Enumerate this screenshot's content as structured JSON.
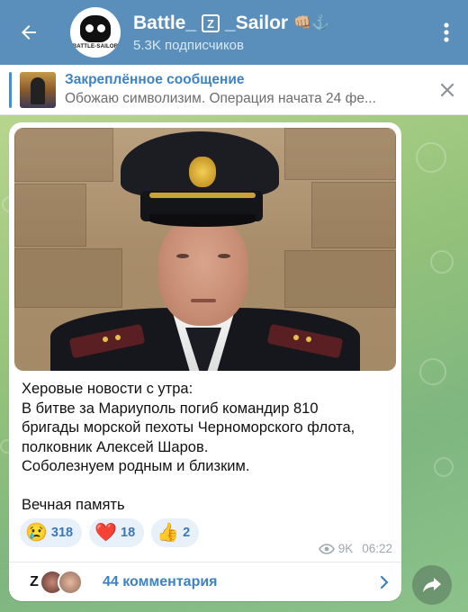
{
  "header": {
    "title_prefix": "Battle_",
    "title_z": "Z",
    "title_suffix": "_Sailor",
    "title_emoji": "👊🏼⚓",
    "subscribers": "5.3K подписчиков",
    "avatar_text": "BATTLE-SAILOR",
    "icons": {
      "back": "arrow-left-icon",
      "menu": "more-vertical-icon"
    }
  },
  "pinned": {
    "title": "Закреплённое сообщение",
    "preview": "Обожаю символизим. Операция начата 24 фе...",
    "icons": {
      "close": "close-icon"
    }
  },
  "message": {
    "lines": [
      "Херовые новости с утра:",
      "В битве за Мариуполь погиб командир 810",
      "бригады морской пехоты Черноморского флота,",
      "полковник Алексей Шаров.",
      "Соболезнуем родным и близким.",
      "",
      "Вечная память"
    ],
    "reactions": [
      {
        "emoji": "😢",
        "count": "318"
      },
      {
        "emoji": "❤️",
        "count": "18"
      },
      {
        "emoji": "👍",
        "count": "2"
      }
    ],
    "views": "9K",
    "time": "06:22",
    "icons": {
      "views": "eye-icon"
    }
  },
  "comments": {
    "label": "44 комментария",
    "first_avatar_letter": "Z",
    "icons": {
      "chevron": "chevron-right-icon",
      "share": "share-icon"
    }
  },
  "colors": {
    "header_bg": "#5a8fbb",
    "accent": "#3d82c4",
    "reaction_bg": "#e8f0fa"
  }
}
